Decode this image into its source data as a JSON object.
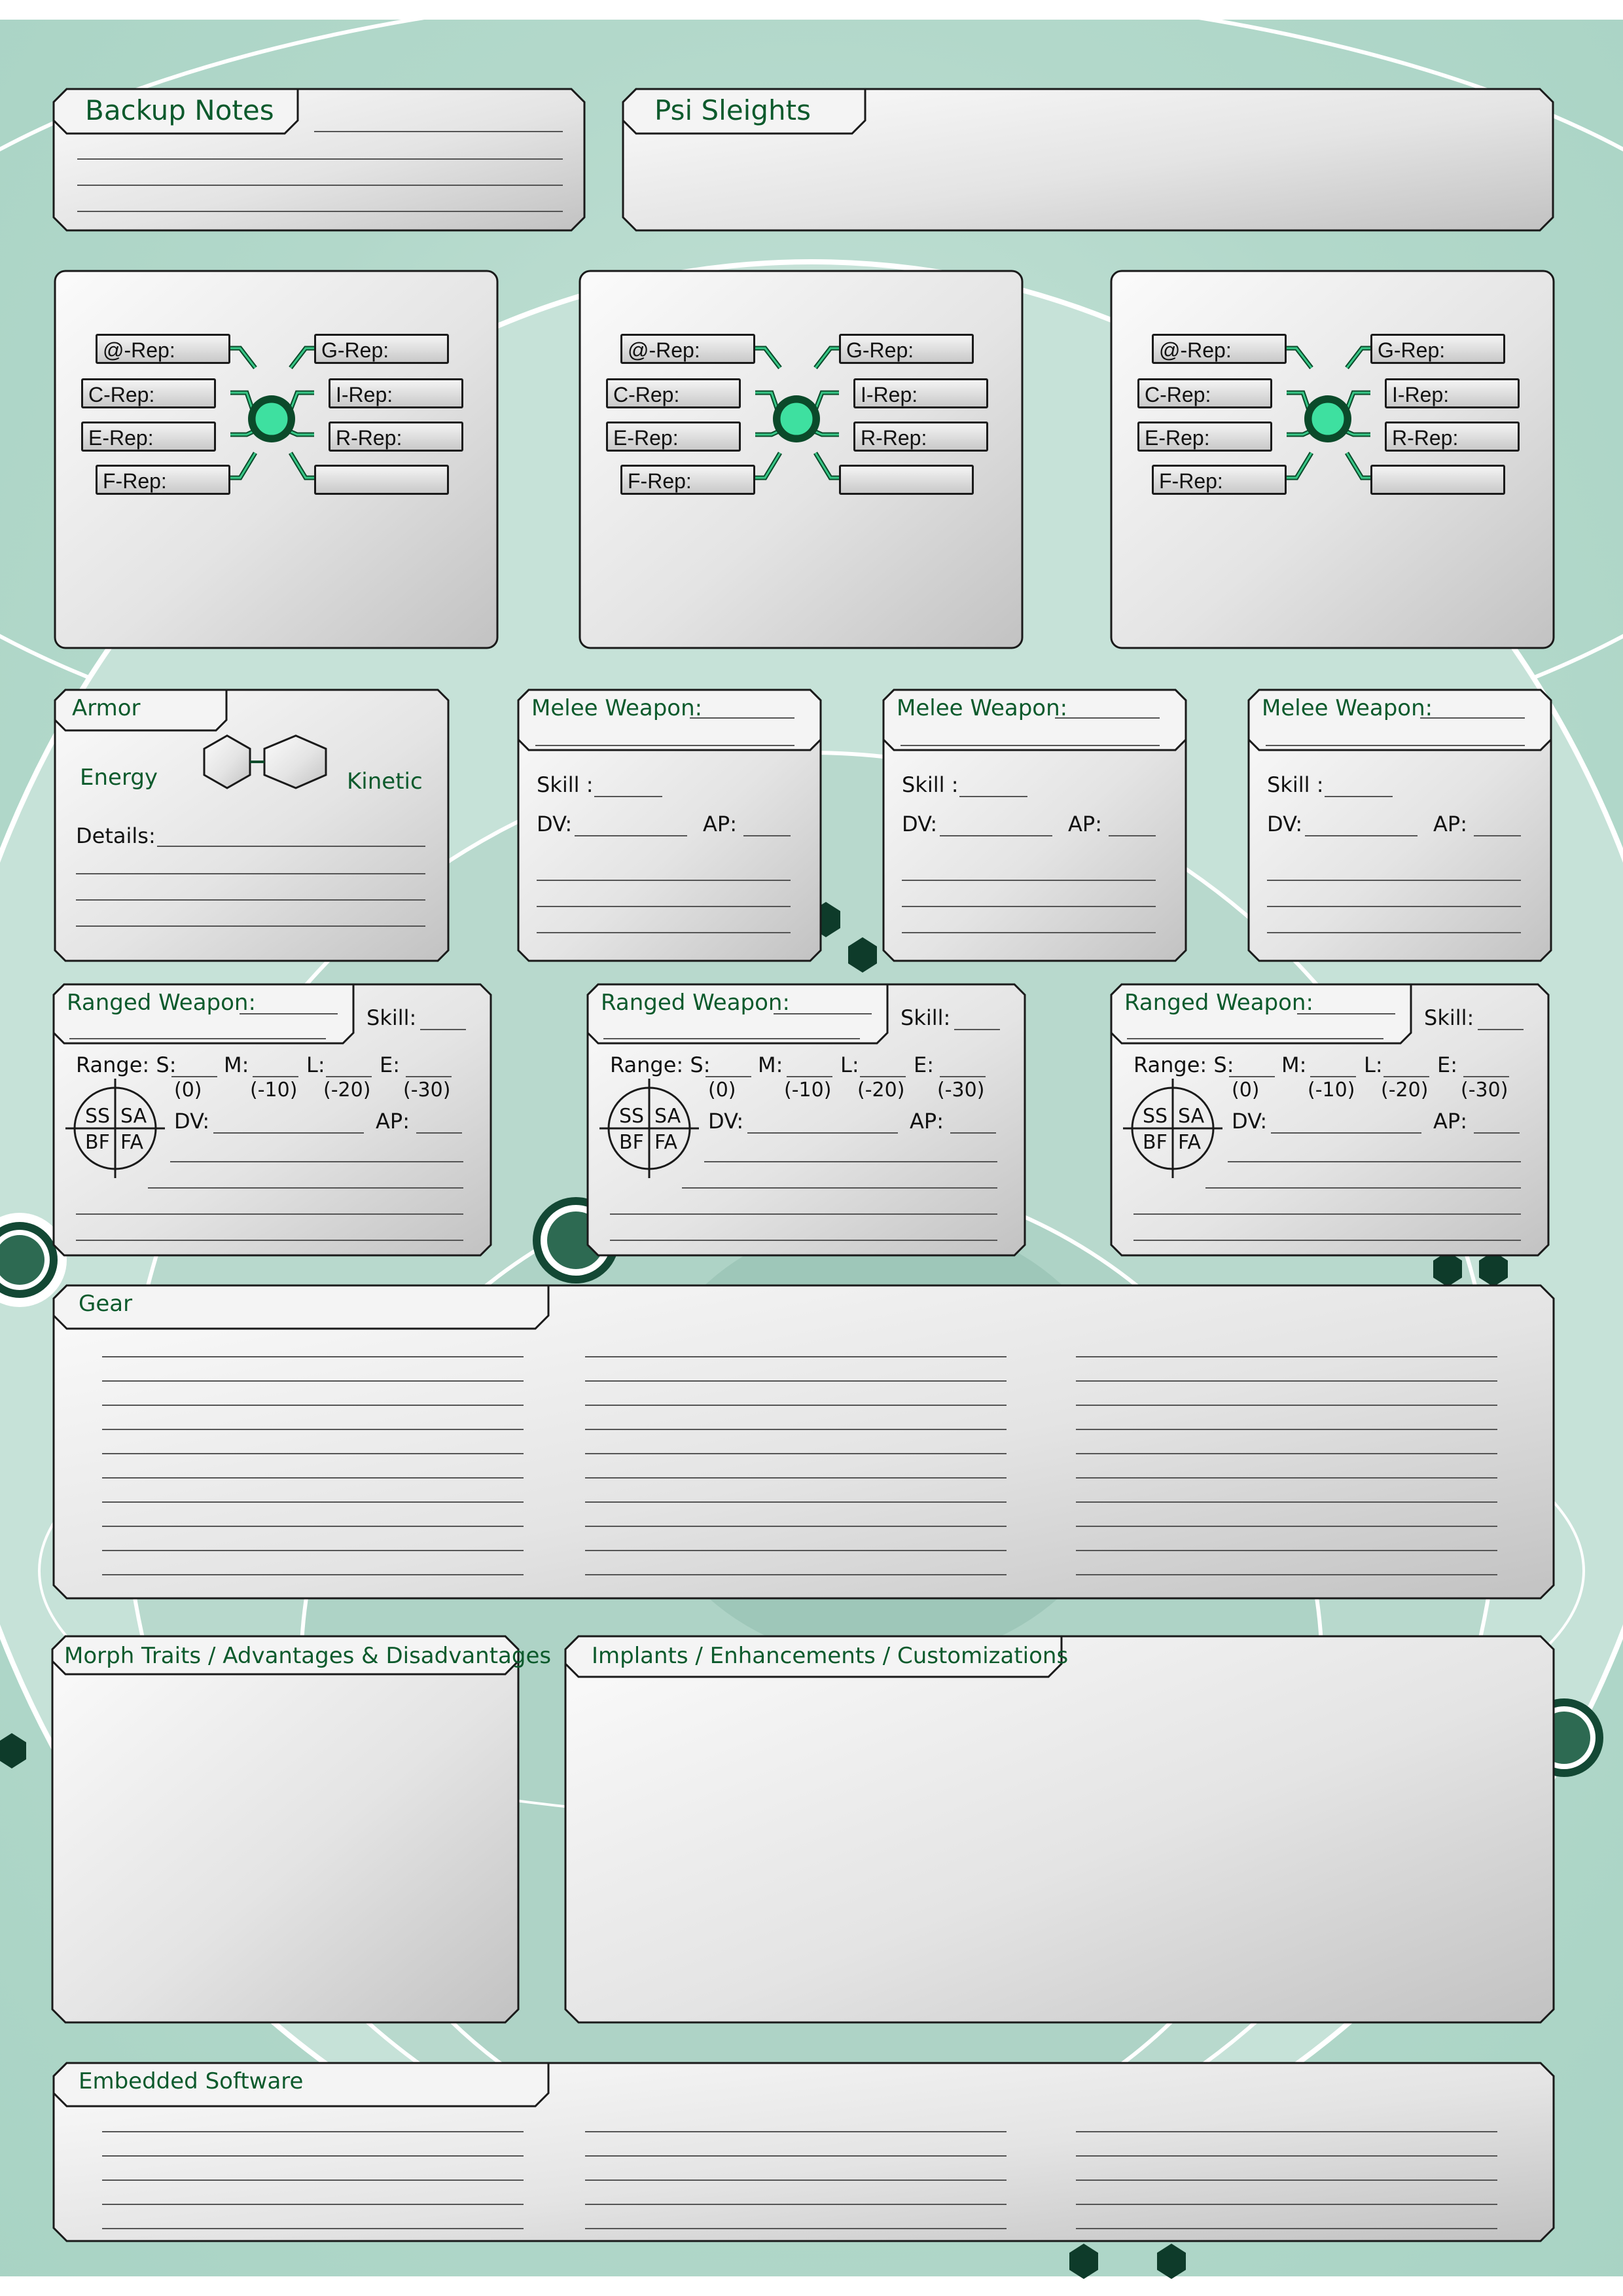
{
  "colors": {
    "accent": "#0c5a2c",
    "node": "#3ee0a0",
    "background": "#bcd9cf",
    "hexagon_dark": "#0e3b2a"
  },
  "backup_notes": {
    "title": "Backup Notes"
  },
  "psi_sleights": {
    "title": "Psi Sleights"
  },
  "rep_panels": [
    {
      "left": [
        "@-Rep:",
        "C-Rep:",
        "E-Rep:",
        "F-Rep:"
      ],
      "right": [
        "G-Rep:",
        "I-Rep:",
        "R-Rep:",
        ""
      ]
    },
    {
      "left": [
        "@-Rep:",
        "C-Rep:",
        "E-Rep:",
        "F-Rep:"
      ],
      "right": [
        "G-Rep:",
        "I-Rep:",
        "R-Rep:",
        ""
      ]
    },
    {
      "left": [
        "@-Rep:",
        "C-Rep:",
        "E-Rep:",
        "F-Rep:"
      ],
      "right": [
        "G-Rep:",
        "I-Rep:",
        "R-Rep:",
        ""
      ]
    }
  ],
  "armor": {
    "title": "Armor",
    "energy": "Energy",
    "kinetic": "Kinetic",
    "details": "Details:"
  },
  "melee": {
    "title": "Melee Weapon:",
    "skill": "Skill :",
    "dv": "DV:",
    "ap": "AP:"
  },
  "ranged": {
    "title": "Ranged Weapon:",
    "skill": "Skill:",
    "range": "Range: S:",
    "m": "M:",
    "l": "L:",
    "e": "E:",
    "mods": [
      "(0)",
      "(-10)",
      "(-20)",
      "(-30)"
    ],
    "dv": "DV:",
    "ap": "AP:",
    "modes": [
      "SS",
      "SA",
      "BF",
      "FA"
    ]
  },
  "gear": {
    "title": "Gear"
  },
  "morph_traits": {
    "title": "Morph Traits / Advantages & Disadvantages"
  },
  "implants": {
    "title": "Implants / Enhancements / Customizations"
  },
  "software": {
    "title": "Embedded Software"
  }
}
